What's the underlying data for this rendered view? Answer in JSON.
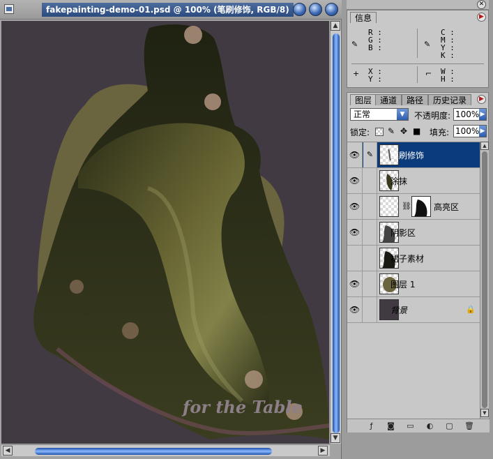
{
  "document": {
    "title": "fakepainting-demo-01.psd @ 100% (笔刷修饰, RGB/8)",
    "canvas_text": "for the Table"
  },
  "info_panel": {
    "tab": "信息",
    "rgb_labels": [
      "R :",
      "G :",
      "B :"
    ],
    "cmyk_labels": [
      "C :",
      "M :",
      "Y :",
      "K :"
    ],
    "xy_labels": [
      "X :",
      "Y :"
    ],
    "wh_labels": [
      "W :",
      "H :"
    ]
  },
  "layers_panel": {
    "tabs": [
      "图层",
      "通道",
      "路径",
      "历史记录"
    ],
    "blend_mode": "正常",
    "opacity_label": "不透明度:",
    "opacity_value": "100%",
    "lock_label": "锁定:",
    "fill_label": "填充:",
    "fill_value": "100%",
    "layers": [
      {
        "name": "笔刷修饰",
        "visible": true,
        "active": true
      },
      {
        "name": "涂抹",
        "visible": true,
        "active": false
      },
      {
        "name": "高亮区",
        "visible": true,
        "active": false
      },
      {
        "name": "阴影区",
        "visible": true,
        "active": false
      },
      {
        "name": "裙子素材",
        "visible": false,
        "active": false
      },
      {
        "name": "图层 1",
        "visible": true,
        "active": false
      },
      {
        "name": "背景",
        "visible": true,
        "active": false
      }
    ]
  },
  "colors": {
    "canvas_bg": "#423a42",
    "selection": "#0c3b7c",
    "scroll_accent": "#2a5fc4"
  }
}
